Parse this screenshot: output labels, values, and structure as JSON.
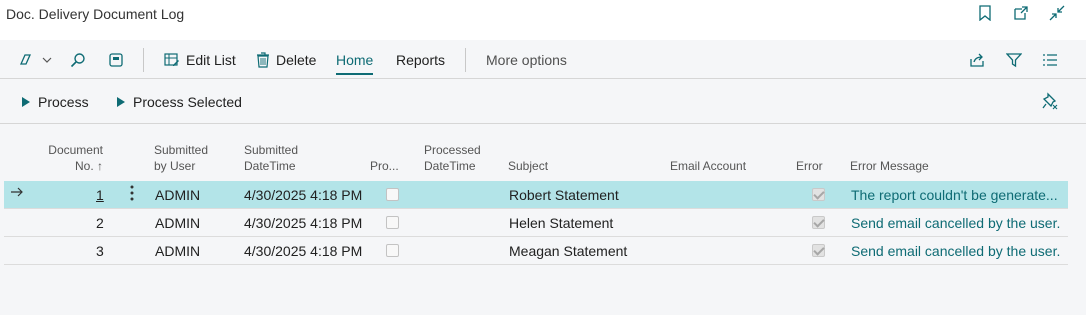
{
  "window": {
    "title": "Doc. Delivery Document Log"
  },
  "commands": {
    "edit_list": "Edit List",
    "delete": "Delete",
    "home": "Home",
    "reports": "Reports",
    "more_options": "More options"
  },
  "actions": {
    "process": "Process",
    "process_selected": "Process Selected"
  },
  "columns": {
    "document_no_1": "Document",
    "document_no_2": "No. ↑",
    "submitted_by_1": "Submitted",
    "submitted_by_2": "by User",
    "submitted_dt_1": "Submitted",
    "submitted_dt_2": "DateTime",
    "processed": "Pro...",
    "processed_dt_1": "Processed",
    "processed_dt_2": "DateTime",
    "subject": "Subject",
    "email_account": "Email Account",
    "error": "Error",
    "error_message": "Error Message"
  },
  "rows": [
    {
      "doc_no": "1",
      "user": "ADMIN",
      "submitted": "4/30/2025 4:18 PM",
      "processed": false,
      "subject": "Robert Statement",
      "error": true,
      "error_message": "The report couldn't be generate..."
    },
    {
      "doc_no": "2",
      "user": "ADMIN",
      "submitted": "4/30/2025 4:18 PM",
      "processed": false,
      "subject": "Helen Statement",
      "error": true,
      "error_message": "Send email cancelled by the user."
    },
    {
      "doc_no": "3",
      "user": "ADMIN",
      "submitted": "4/30/2025 4:18 PM",
      "processed": false,
      "subject": "Meagan Statement",
      "error": true,
      "error_message": "Send email cancelled by the user."
    }
  ],
  "colors": {
    "accent": "#0e6b74",
    "selected_row": "#b3e4e8"
  }
}
